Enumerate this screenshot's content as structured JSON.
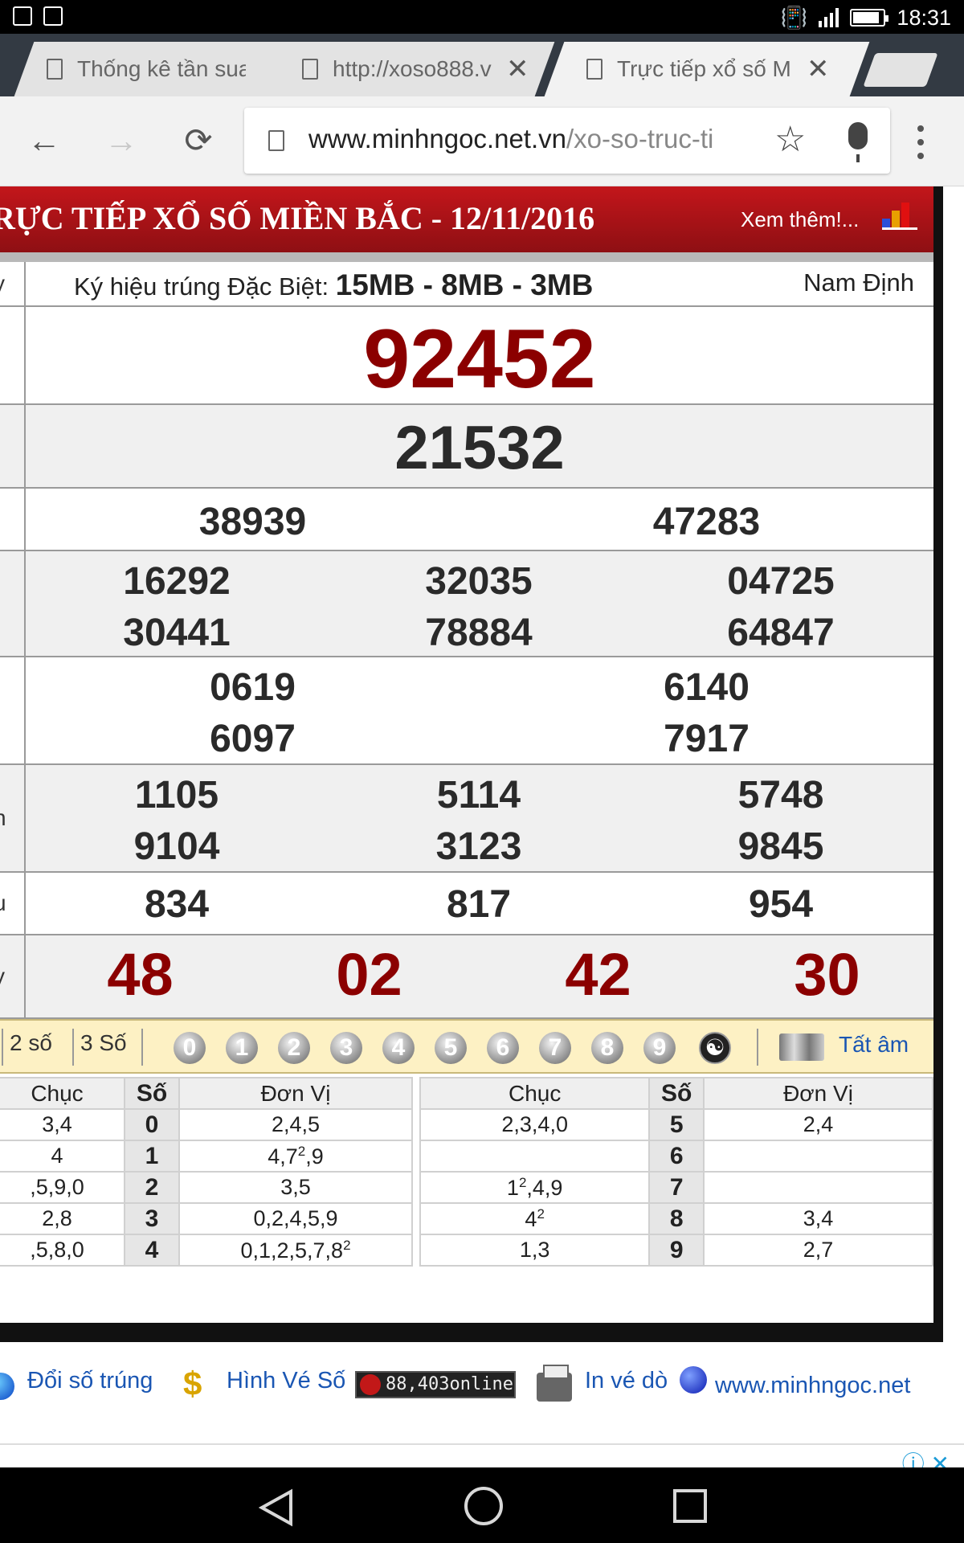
{
  "status_bar": {
    "time": "18:31"
  },
  "tabs": [
    {
      "title": "Thống kê tần sua",
      "has_close": false
    },
    {
      "title": "http://xoso888.v",
      "has_close": true
    },
    {
      "title": "Trực tiếp xổ số M",
      "has_close": true,
      "active": true
    }
  ],
  "toolbar": {
    "url_host": "www.minhngoc.net.vn",
    "url_path": "/xo-so-truc-ti",
    "back_icon": "arrow-left-icon",
    "forward_icon": "arrow-right-icon",
    "reload_icon": "reload-icon"
  },
  "results": {
    "header_title": "RỰC TIẾP XỔ SỐ MIỀN BẮC - 12/11/2016",
    "header_more": "Xem thêm!...",
    "symbol_label": "Ký hiệu trúng Đặc Biệt:",
    "symbol_value": "15MB - 8MB - 3MB",
    "province": "Nam Định",
    "row_labels": [
      "y",
      "",
      "t",
      "i",
      "",
      "",
      "n",
      "u",
      "y"
    ],
    "special": "92452",
    "first": "21532",
    "second": [
      "38939",
      "47283"
    ],
    "third": [
      "16292",
      "32035",
      "04725",
      "30441",
      "78884",
      "64847"
    ],
    "fourth": [
      "0619",
      "6140",
      "6097",
      "7917"
    ],
    "fifth": [
      "1105",
      "5114",
      "5748",
      "9104",
      "3123",
      "9845"
    ],
    "sixth": [
      "834",
      "817",
      "954"
    ],
    "seventh": [
      "48",
      "02",
      "42",
      "30"
    ]
  },
  "filter_bar": {
    "two_digits": "2 số",
    "three_digits": "3 Số",
    "balls": [
      "0",
      "1",
      "2",
      "3",
      "4",
      "5",
      "6",
      "7",
      "8",
      "9"
    ],
    "mute_label": "Tất âm"
  },
  "loto": {
    "headers": {
      "chuc": "Chục",
      "so": "Số",
      "don_vi": "Đơn Vị"
    },
    "left": [
      {
        "chuc": "3,4",
        "so": "0",
        "don_vi": "2,4,5"
      },
      {
        "chuc": "4",
        "so": "1",
        "don_vi": "4,7²,9"
      },
      {
        "chuc": ",5,9,0",
        "so": "2",
        "don_vi": "3,5"
      },
      {
        "chuc": "2,8",
        "so": "3",
        "don_vi": "0,2,4,5,9"
      },
      {
        "chuc": ",5,8,0",
        "so": "4",
        "don_vi": "0,1,2,5,7,8²"
      }
    ],
    "right": [
      {
        "chuc": "2,3,4,0",
        "so": "5",
        "don_vi": "2,4"
      },
      {
        "chuc": "",
        "so": "6",
        "don_vi": ""
      },
      {
        "chuc": "1²,4,9",
        "so": "7",
        "don_vi": ""
      },
      {
        "chuc": "4²",
        "so": "8",
        "don_vi": "3,4"
      },
      {
        "chuc": "1,3",
        "so": "9",
        "don_vi": "2,7"
      }
    ]
  },
  "footer": {
    "doi_so": "Đổi số trúng",
    "hinh_ve": "Hình Vé Số",
    "online": "88,403online",
    "in_ve": "In vé dò",
    "site": "www.minhngoc.net"
  },
  "colors": {
    "header_red": "#b5141a",
    "special_red": "#8b0000",
    "link_blue": "#1a56b3",
    "filter_bg": "#fdf1c4"
  }
}
